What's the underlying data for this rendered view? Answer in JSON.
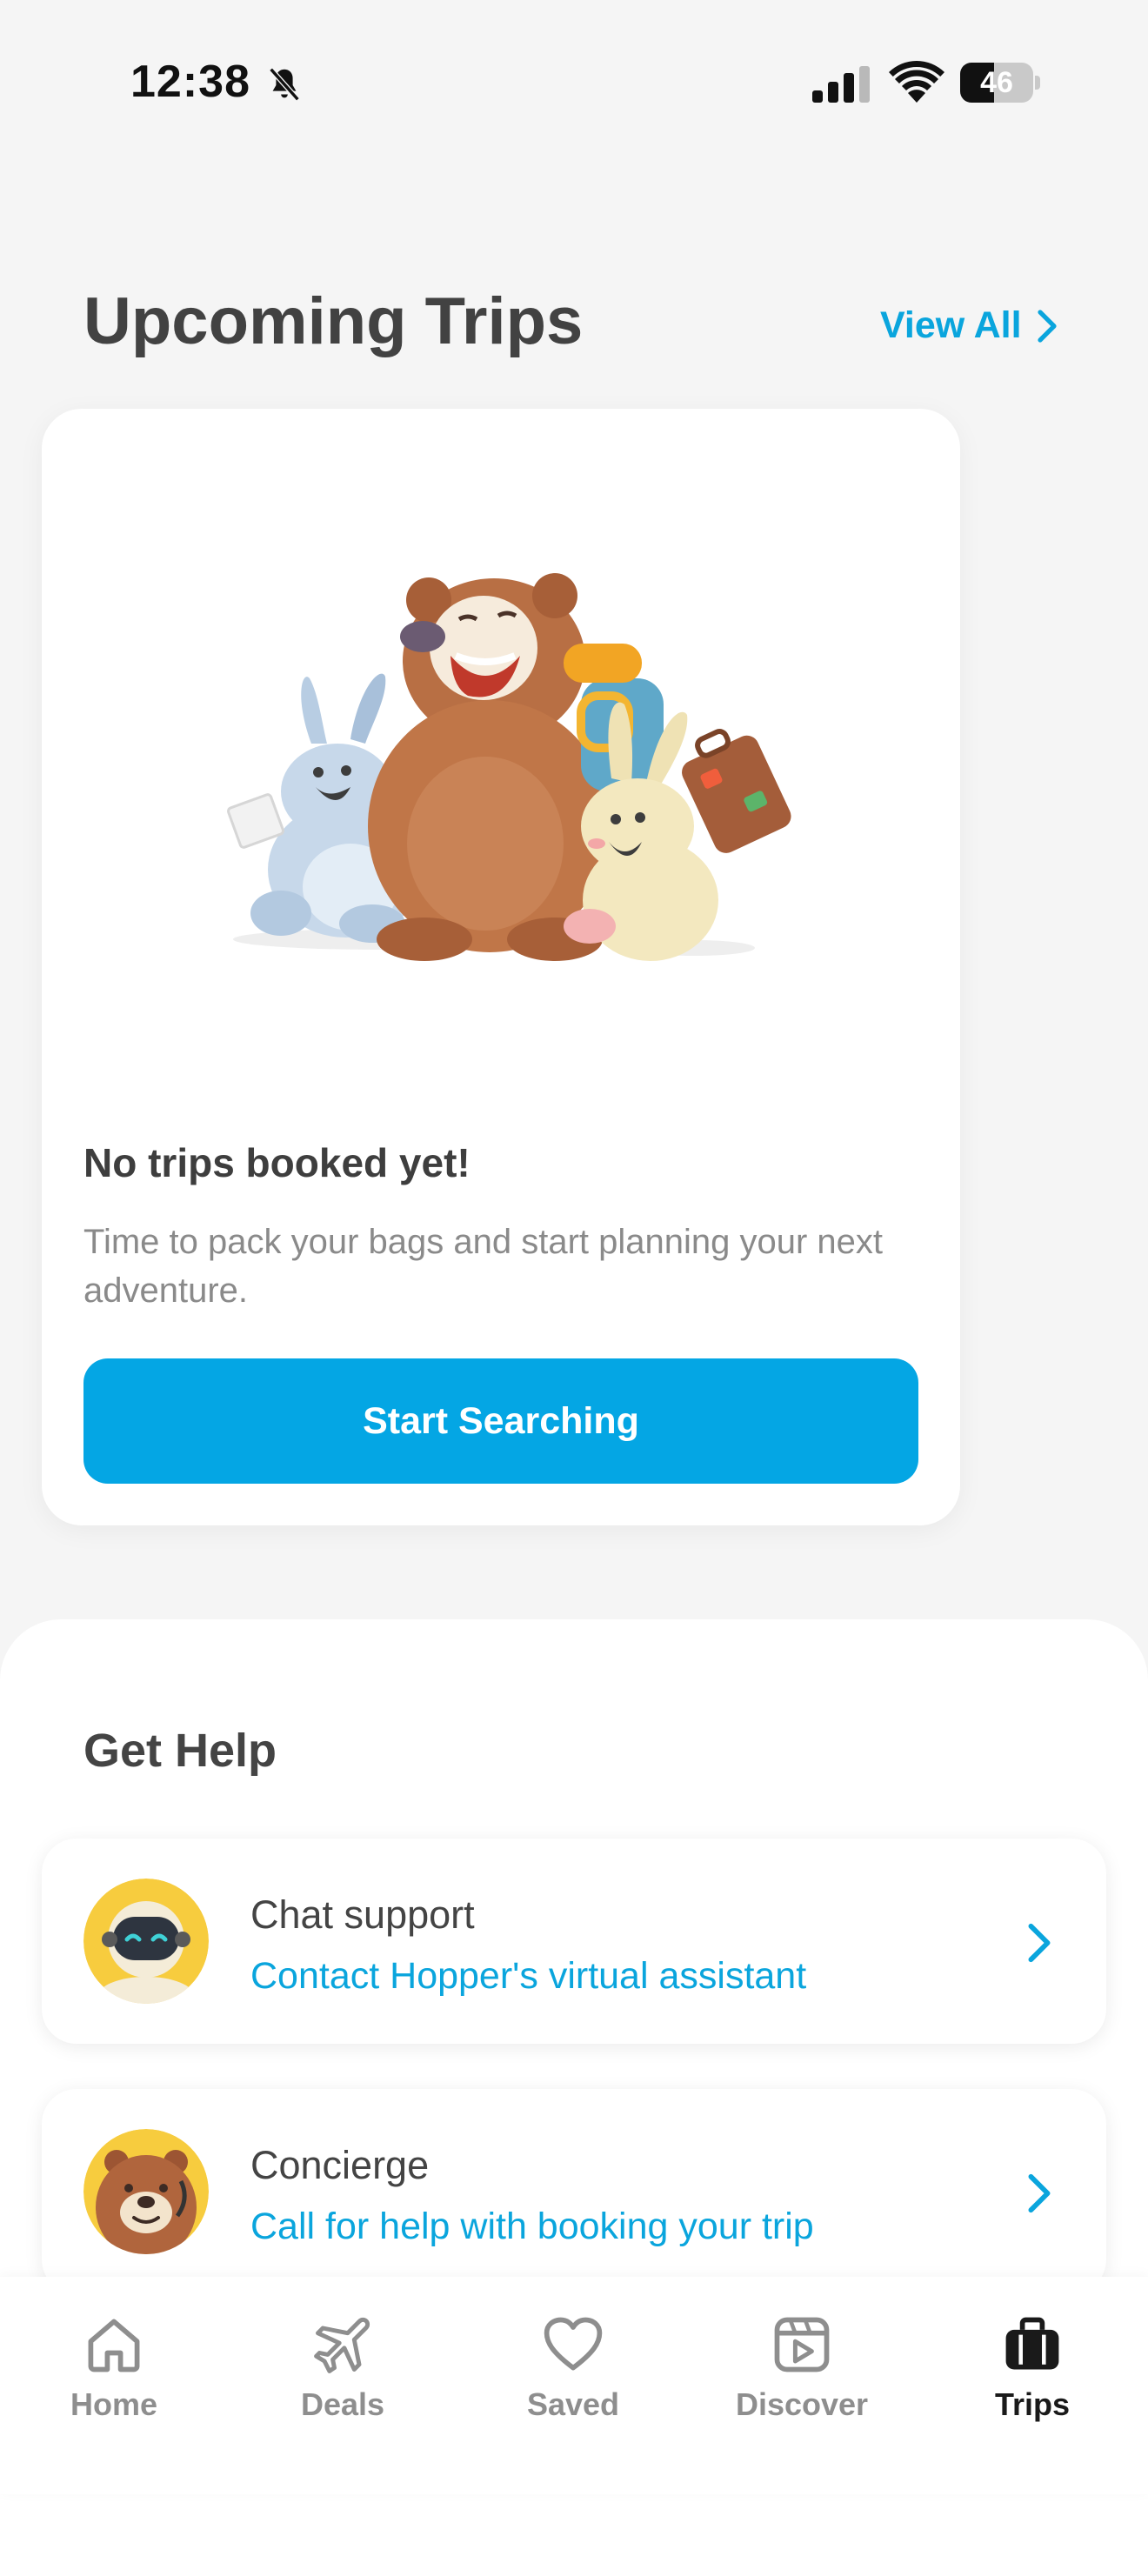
{
  "status_bar": {
    "time": "12:38",
    "battery_level": "46",
    "battery_fraction": 0.46,
    "icons": [
      "bell-slash-icon",
      "cellular-signal-icon",
      "wifi-icon",
      "battery-icon"
    ]
  },
  "upcoming": {
    "title": "Upcoming Trips",
    "view_all_label": "View All",
    "empty_title": "No trips booked yet!",
    "empty_description": "Time to pack your bags and start planning your next adventure.",
    "cta_label": "Start Searching"
  },
  "help": {
    "title": "Get Help",
    "items": [
      {
        "title": "Chat support",
        "subtitle": "Contact Hopper's virtual assistant",
        "icon": "robot-avatar-icon"
      },
      {
        "title": "Concierge",
        "subtitle": "Call for help with booking your trip",
        "icon": "bear-avatar-icon"
      }
    ]
  },
  "tabs": [
    {
      "label": "Home",
      "icon": "home-icon",
      "active": false
    },
    {
      "label": "Deals",
      "icon": "plane-icon",
      "active": false
    },
    {
      "label": "Saved",
      "icon": "heart-icon",
      "active": false
    },
    {
      "label": "Discover",
      "icon": "video-icon",
      "active": false
    },
    {
      "label": "Trips",
      "icon": "suitcase-icon",
      "active": true
    }
  ],
  "colors": {
    "accent": "#04a6e4",
    "link": "#0aa5dd",
    "background": "#f5f5f5",
    "avatar_yellow": "#f7cc3e"
  }
}
